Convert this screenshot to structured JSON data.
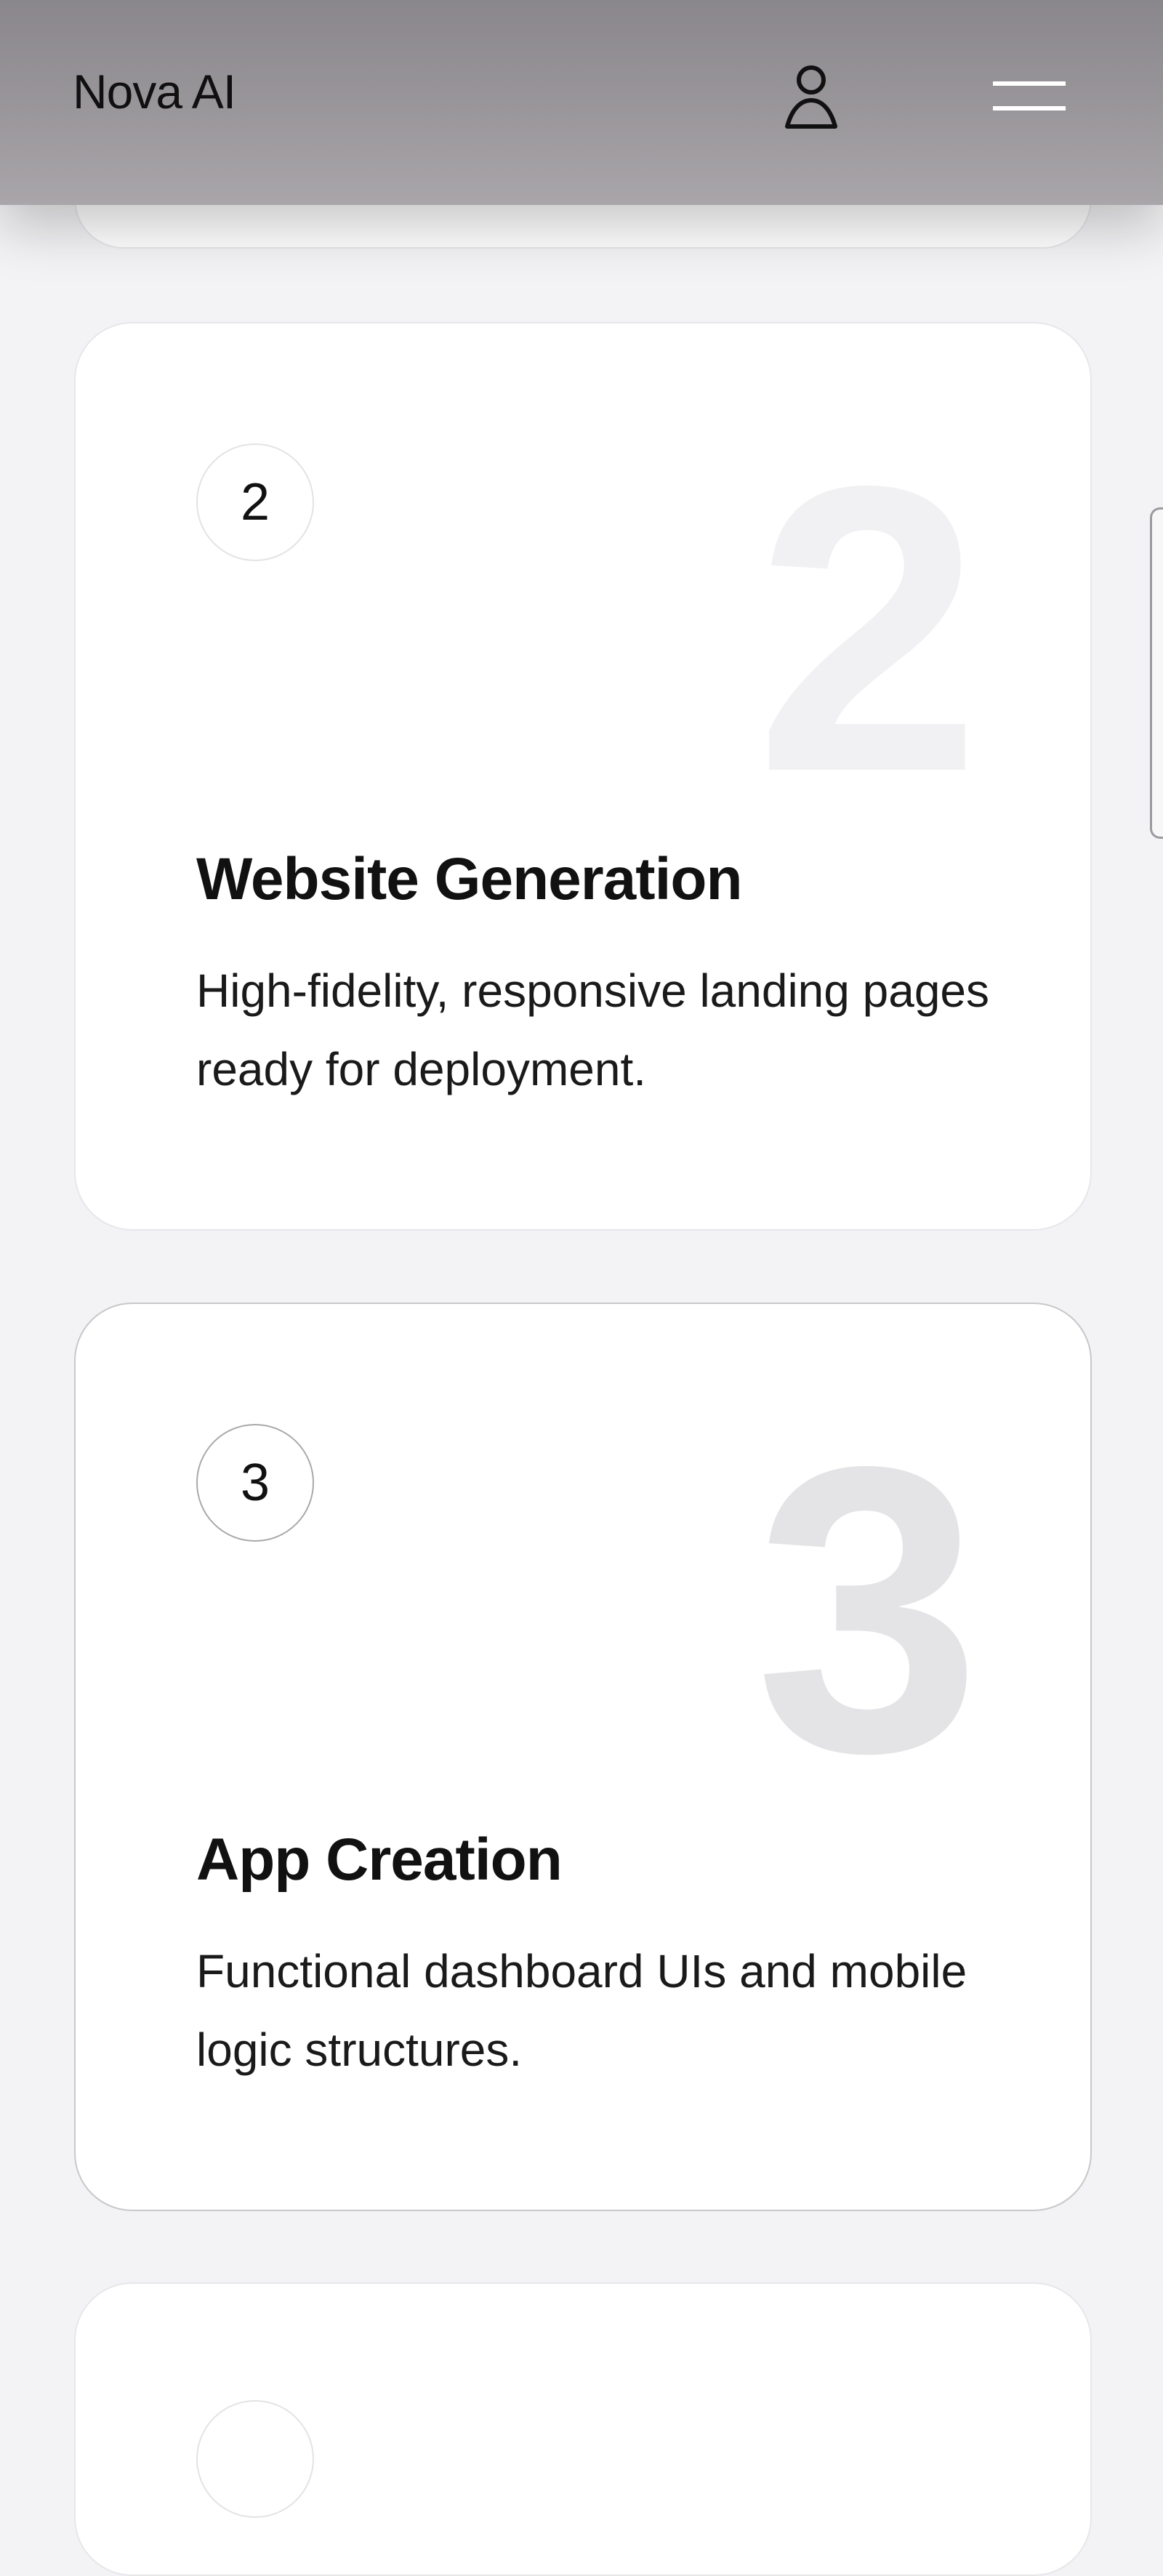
{
  "header": {
    "brand": "Nova AI",
    "user_icon": "user-icon",
    "menu_icon": "hamburger-menu-icon"
  },
  "cards": [
    {
      "number": "2",
      "title": "Website Generation",
      "description": "High-fidelity, responsive landing pages ready for deployment."
    },
    {
      "number": "3",
      "title": "App Creation",
      "description": "Functional dashboard UIs and mobile logic structures."
    }
  ],
  "colors": {
    "page_background": "#f3f3f5",
    "header_background": "#9a979b",
    "card_background": "#ffffff",
    "text": "#111111",
    "watermark_number": "#e4e4e6"
  }
}
